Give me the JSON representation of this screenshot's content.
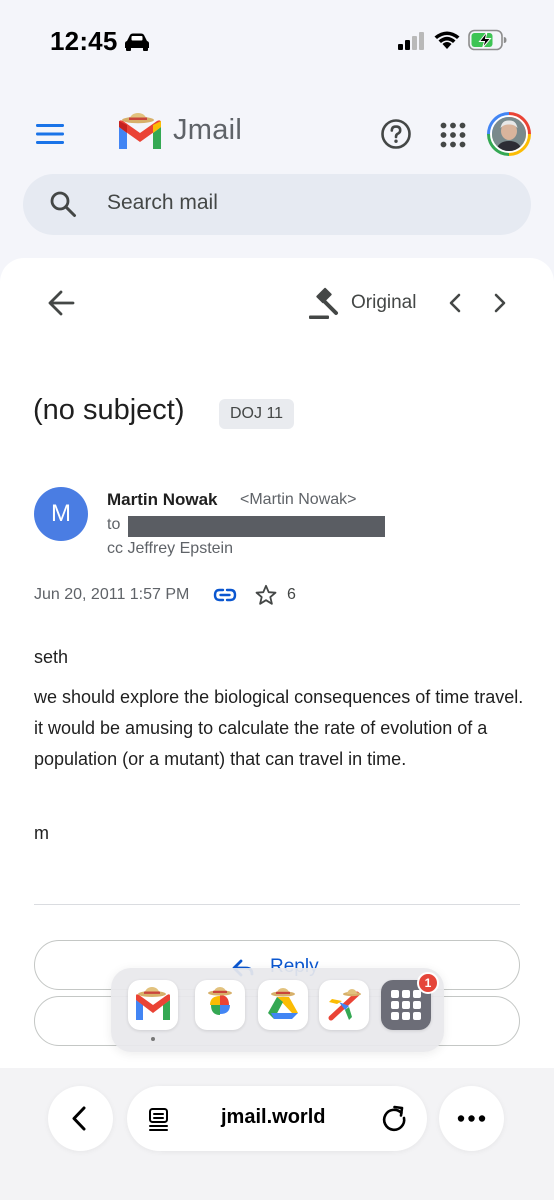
{
  "status_bar": {
    "time": "12:45"
  },
  "header": {
    "app_name": "Jmail",
    "search_placeholder": "Search mail"
  },
  "toolbar": {
    "original_label": "Original"
  },
  "email": {
    "subject": "(no subject)",
    "label": "DOJ 11",
    "sender_initial": "M",
    "sender_name": "Martin Nowak",
    "sender_email": "<Martin Nowak>",
    "to_label": "to",
    "cc": "cc Jeffrey Epstein",
    "date": "Jun 20, 2011 1:57 PM",
    "star_count": "6",
    "body": [
      "seth",
      "we should explore the biological consequences of time travel. it would be amusing to calculate the rate of evolution of a population (or a mutant) that can travel in time.",
      "m"
    ]
  },
  "actions": {
    "reply_label": "Reply"
  },
  "dock": {
    "badge_count": "1"
  },
  "browser": {
    "url": "jmail.world"
  },
  "colors": {
    "accent_blue": "#0b57d0",
    "sender_avatar": "#4a7de3",
    "redaction": "#5a5d63",
    "badge_red": "#e5453a"
  }
}
